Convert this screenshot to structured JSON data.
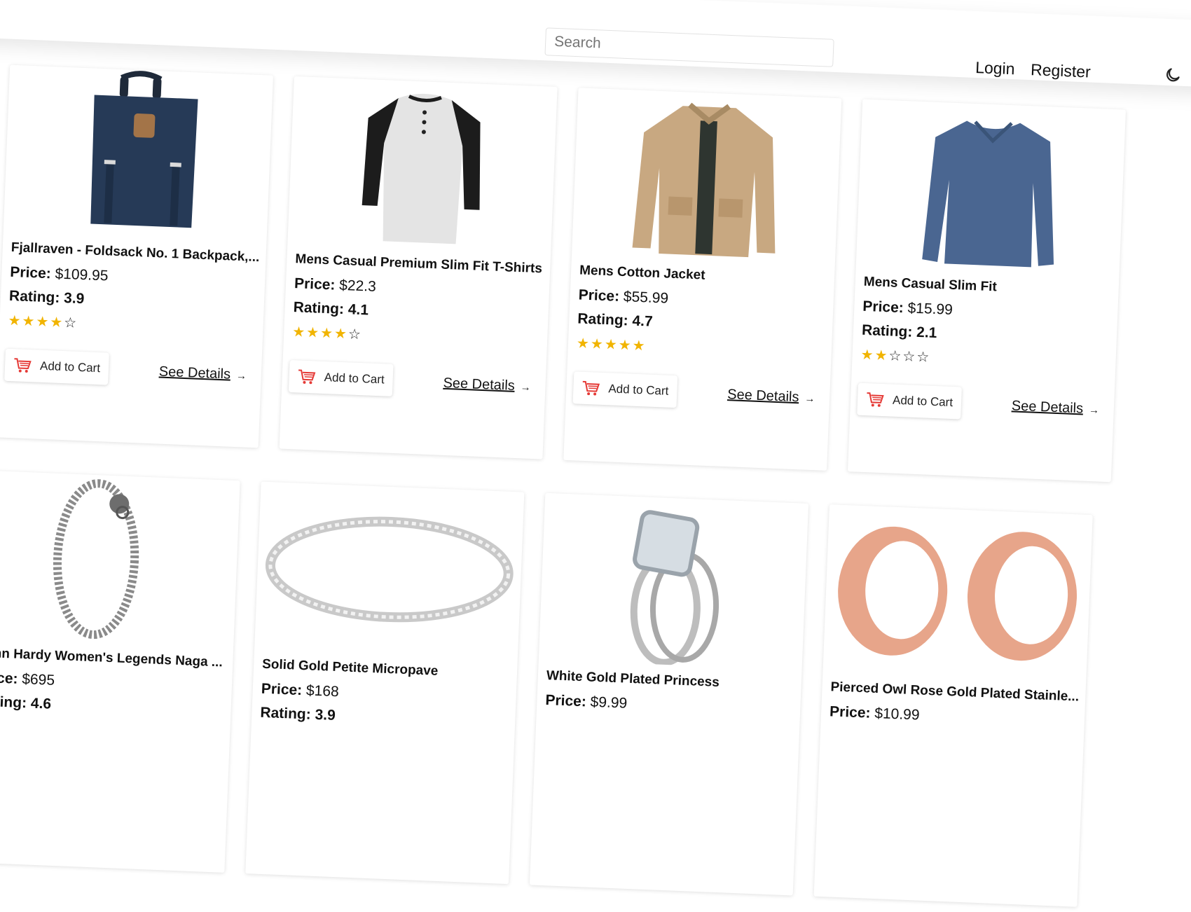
{
  "header": {
    "search_placeholder": "Search",
    "login_label": "Login",
    "register_label": "Register",
    "theme_icon": "moon-icon"
  },
  "products": [
    {
      "title": "Fjallraven - Foldsack No. 1 Backpack,...",
      "price_label": "Price:",
      "price": "$109.95",
      "rating_label": "Rating:",
      "rating": "3.9",
      "stars_filled": 4,
      "image_icon": "backpack-image"
    },
    {
      "title": "Mens Casual Premium Slim Fit T-Shirts",
      "price_label": "Price:",
      "price": "$22.3",
      "rating_label": "Rating:",
      "rating": "4.1",
      "stars_filled": 4,
      "image_icon": "tshirt-image"
    },
    {
      "title": "Mens Cotton Jacket",
      "price_label": "Price:",
      "price": "$55.99",
      "rating_label": "Rating:",
      "rating": "4.7",
      "stars_filled": 5,
      "image_icon": "jacket-image"
    },
    {
      "title": "Mens Casual Slim Fit",
      "price_label": "Price:",
      "price": "$15.99",
      "rating_label": "Rating:",
      "rating": "2.1",
      "stars_filled": 2,
      "image_icon": "longsleeve-image"
    },
    {
      "title": "John Hardy Women's Legends Naga ...",
      "price_label": "Price:",
      "price": "$695",
      "rating_label": "Rating:",
      "rating": "4.6",
      "image_icon": "bracelet-image"
    },
    {
      "title": "Solid Gold Petite Micropave",
      "price_label": "Price:",
      "price": "$168",
      "rating_label": "Rating:",
      "rating": "3.9",
      "image_icon": "ring-image"
    },
    {
      "title": "White Gold Plated Princess",
      "price_label": "Price:",
      "price": "$9.99",
      "image_icon": "diamond-ring-image"
    },
    {
      "title": "Pierced Owl Rose Gold Plated Stainle...",
      "price_label": "Price:",
      "price": "$10.99",
      "image_icon": "earrings-image"
    }
  ],
  "actions": {
    "add_to_cart_label": "Add to Cart",
    "see_details_label": "See Details",
    "cart_icon": "cart-icon",
    "arrow_icon": "arrow-right-icon"
  },
  "colors": {
    "star": "#f1b400",
    "cart_icon": "#e53935",
    "navbar_bg": "#ffffff"
  }
}
